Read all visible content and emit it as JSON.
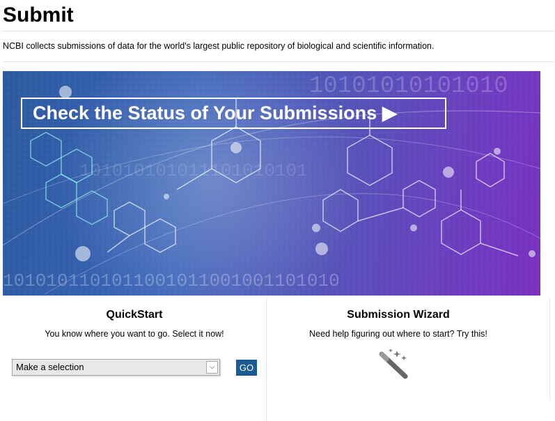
{
  "header": {
    "title": "Submit",
    "intro": "NCBI collects submissions of data for the world's largest public repository of biological and scientific information."
  },
  "banner": {
    "link_text": "Check the Status of Your Submissions",
    "arrow": "▶",
    "binary_top": "10101010101010",
    "binary_mid": "101010101011101010101",
    "binary_bottom": "1010101101011001011001001101010"
  },
  "quickstart": {
    "title": "QuickStart",
    "text": "You know where you want to go. Select it now!",
    "select_value": "Make a selection",
    "go_label": "GO"
  },
  "wizard": {
    "title": "Submission Wizard",
    "text": "Need help figuring out where to start? Try this!",
    "icon": "magic-wand-icon"
  },
  "colors": {
    "go_button": "#1a5b94",
    "banner_start": "#2c5aa0",
    "banner_end": "#7a2fc0"
  }
}
